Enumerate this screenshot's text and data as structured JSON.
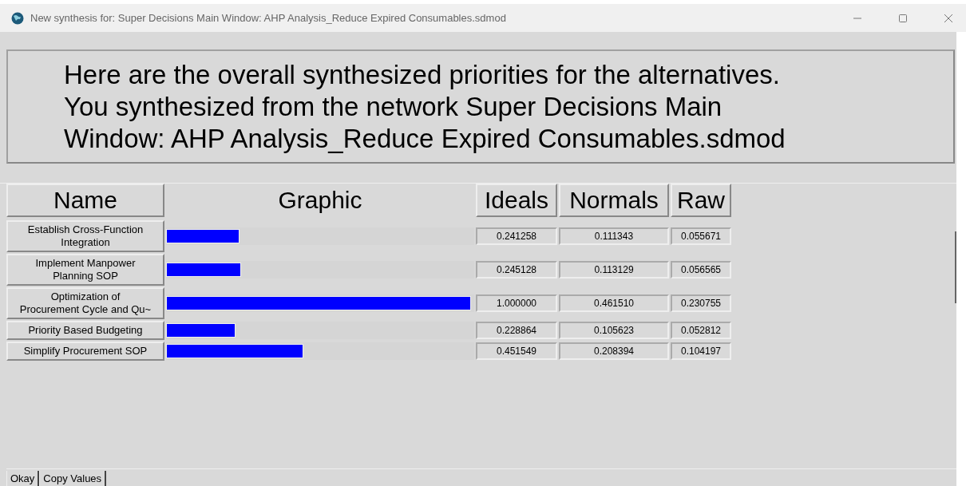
{
  "window": {
    "title": "New synthesis for: Super Decisions Main Window: AHP Analysis_Reduce Expired Consumables.sdmod"
  },
  "message": [
    "Here are the overall synthesized priorities for the alternatives.",
    "You synthesized from the network Super Decisions Main",
    "Window: AHP Analysis_Reduce Expired Consumables.sdmod"
  ],
  "table": {
    "columns": [
      "Name",
      "Graphic",
      "Ideals",
      "Normals",
      "Raw"
    ],
    "rows": [
      {
        "name": [
          "Establish Cross-Function",
          "Integration"
        ],
        "level": 0.241258,
        "ideals": "0.241258",
        "normals": "0.111343",
        "raw": "0.055671"
      },
      {
        "name": [
          "Implement Manpower",
          "Planning SOP"
        ],
        "level": 0.245128,
        "ideals": "0.245128",
        "normals": "0.113129",
        "raw": "0.056565"
      },
      {
        "name": [
          "Optimization of",
          "Procurement Cycle and Qu~"
        ],
        "level": 1.0,
        "ideals": "1.000000",
        "normals": "0.461510",
        "raw": "0.230755"
      },
      {
        "name": [
          "Priority Based Budgeting"
        ],
        "level": 0.228864,
        "ideals": "0.228864",
        "normals": "0.105623",
        "raw": "0.052812"
      },
      {
        "name": [
          "Simplify Procurement SOP"
        ],
        "level": 0.451549,
        "ideals": "0.451549",
        "normals": "0.208394",
        "raw": "0.104197"
      }
    ]
  },
  "buttons": [
    "Okay",
    "Copy Values"
  ]
}
